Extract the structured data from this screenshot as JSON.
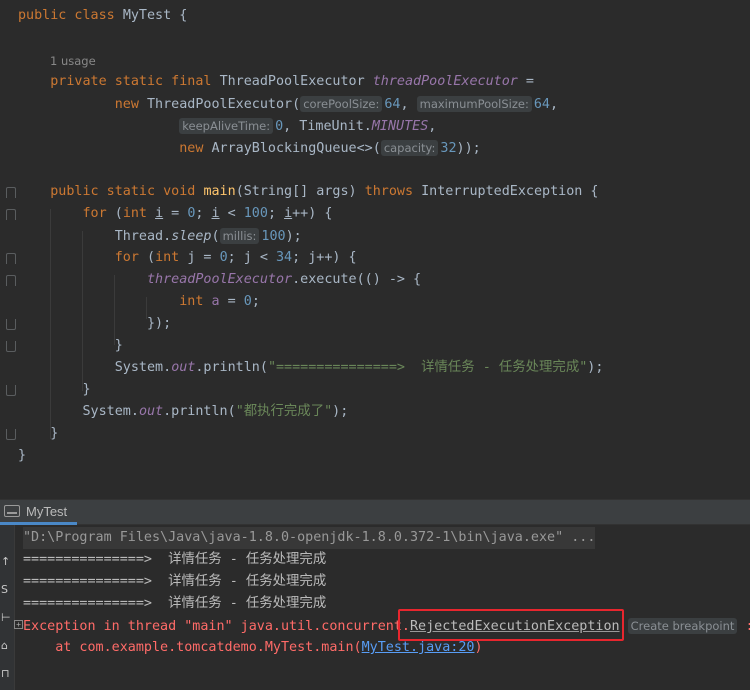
{
  "editor": {
    "usage_hint": "1 usage",
    "hints": {
      "corePoolSize": "corePoolSize:",
      "maximumPoolSize": "maximumPoolSize:",
      "keepAliveTime": "keepAliveTime:",
      "capacity": "capacity:",
      "millis": "millis:"
    },
    "class_name": "MyTest",
    "field_type": "ThreadPoolExecutor",
    "field_name": "threadPoolExecutor",
    "core_pool_size": "64",
    "max_pool_size": "64",
    "keep_alive": "0",
    "time_unit": "MINUTES",
    "queue_capacity": "32",
    "loop_limit_outer": "100",
    "sleep_ms": "100",
    "loop_limit_inner": "34",
    "string_task_done": "\"===============>  详情任务 - 任务处理完成\"",
    "string_all_done": "\"都执行完成了\""
  },
  "run_panel": {
    "tab_label": "MyTest",
    "command_line": "\"D:\\Program Files\\Java\\java-1.8.0-openjdk-1.8.0.372-1\\bin\\java.exe\" ...",
    "output_lines": [
      "===============>  详情任务 - 任务处理完成",
      "===============>  详情任务 - 任务处理完成",
      "===============>  详情任务 - 任务处理完成"
    ],
    "exception_prefix": "Exception in thread \"main\" java.util.concurrent.",
    "exception_class": "RejectedExecutionException",
    "create_breakpoint": "Create breakpoint",
    "exception_colon": " :",
    "stack_prefix": "    at com.example.tomcatdemo.MyTest.main(",
    "stack_link": "MyTest.java:20",
    "stack_suffix": ")"
  },
  "colors": {
    "background": "#2b2b2b",
    "keyword": "#cc7832",
    "error_text": "#ff6b68",
    "link": "#589df6",
    "highlight_box": "#e8262e"
  }
}
